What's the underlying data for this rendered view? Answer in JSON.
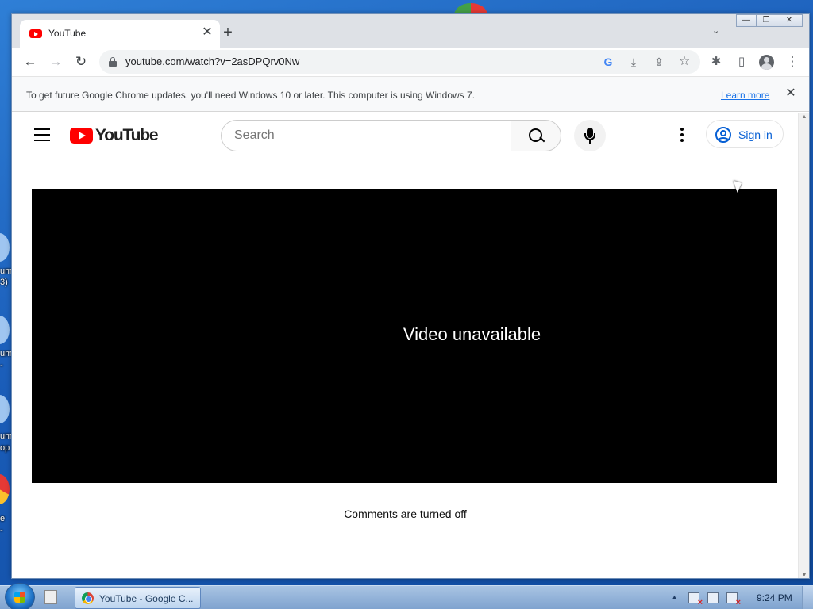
{
  "desktop": {
    "icon_labels": [
      "um",
      "3)",
      "um",
      "-",
      "um",
      "op",
      "e",
      "-"
    ]
  },
  "tab": {
    "title": "YouTube",
    "close": "✕",
    "new_tab": "+",
    "tab_search": "⌄"
  },
  "window_controls": {
    "minimize": "—",
    "restore": "❐",
    "close": "✕"
  },
  "toolbar": {
    "back": "←",
    "forward": "→",
    "reload": "↻",
    "url": "youtube.com/watch?v=2asDPQrv0Nw",
    "google_lens": "G",
    "install": "⤓",
    "share": "⇪",
    "bookmark": "☆",
    "extensions": "✱",
    "side_panel": "▯",
    "menu": "⋮"
  },
  "infobar": {
    "message": "To get future Google Chrome updates, you'll need Windows 10 or later. This computer is using Windows 7.",
    "link": "Learn more",
    "close": "✕"
  },
  "youtube": {
    "logo_text": "YouTube",
    "search_placeholder": "Search",
    "sign_in": "Sign in",
    "player_message": "Video unavailable",
    "comments_message": "Comments are turned off"
  },
  "taskbar": {
    "app_label": "YouTube - Google C...",
    "clock": "9:24 PM",
    "tray_up": "▲"
  },
  "colors": {
    "youtube_red": "#ff0000",
    "link_blue": "#065fd4",
    "chrome_link": "#1a73e8"
  }
}
